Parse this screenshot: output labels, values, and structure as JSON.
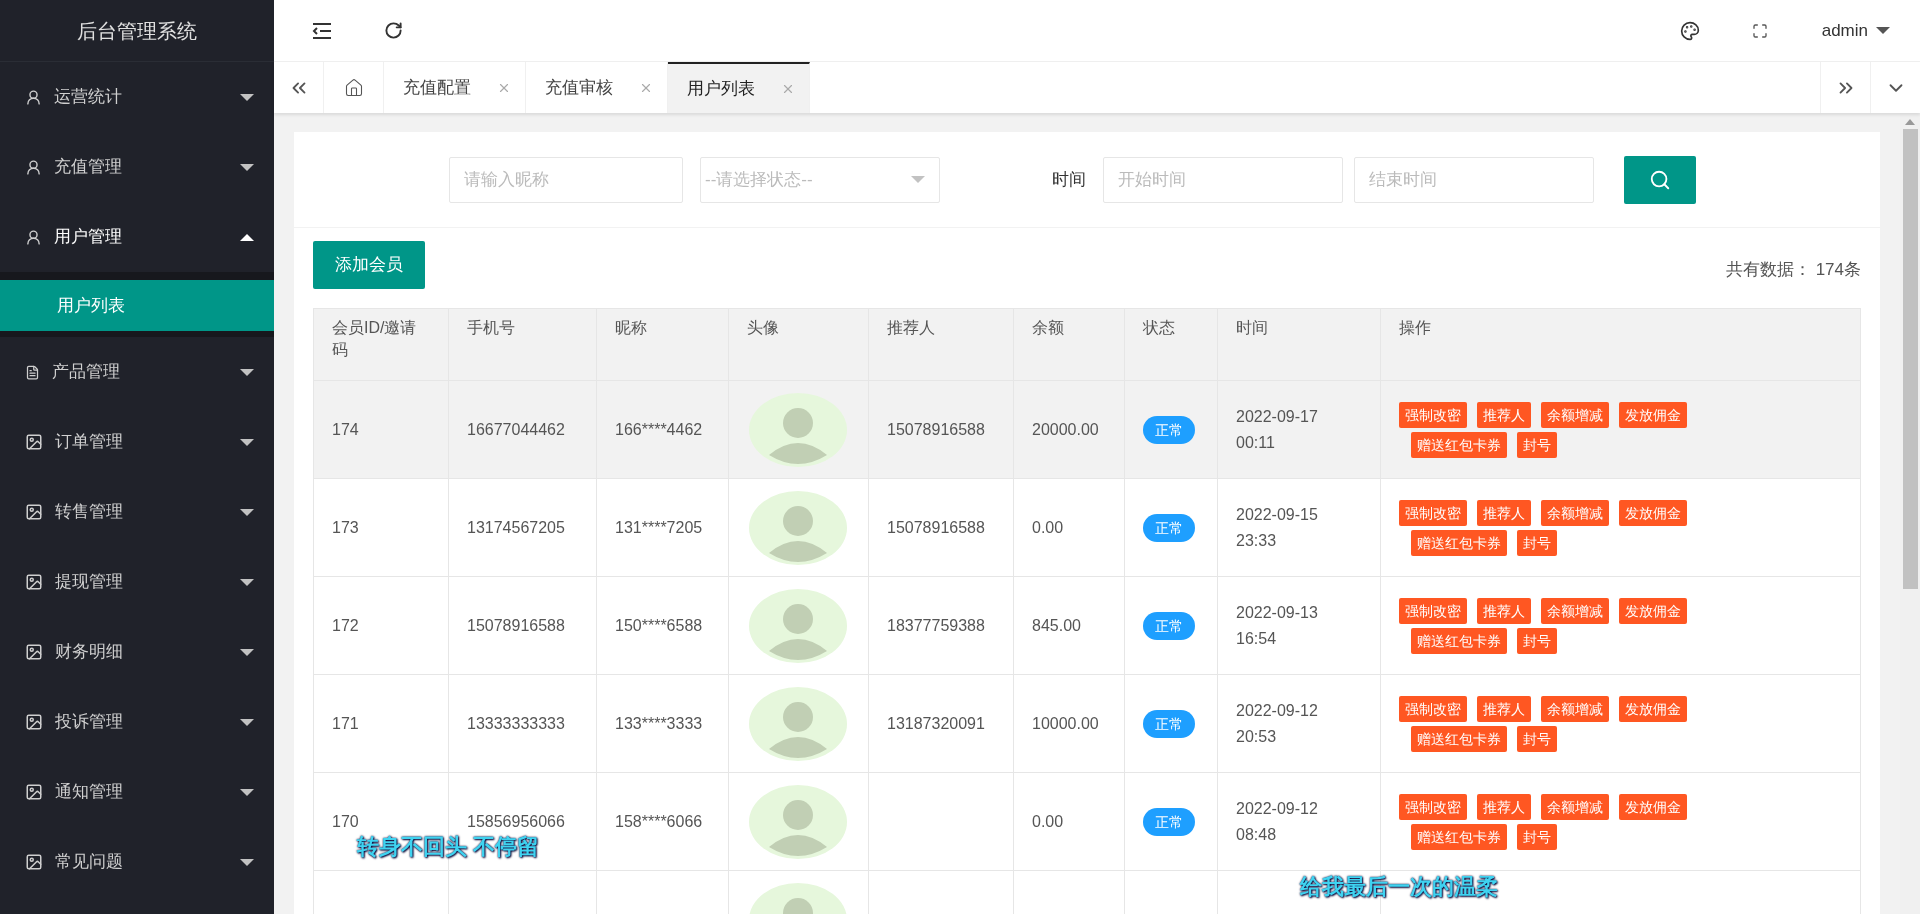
{
  "sidebar": {
    "title": "后台管理系统",
    "items": [
      {
        "label": "运营统计",
        "expanded": false
      },
      {
        "label": "充值管理",
        "expanded": false
      },
      {
        "label": "用户管理",
        "expanded": true,
        "children": [
          {
            "label": "用户列表",
            "selected": true
          }
        ]
      },
      {
        "label": "产品管理",
        "expanded": false
      },
      {
        "label": "订单管理",
        "expanded": false
      },
      {
        "label": "转售管理",
        "expanded": false
      },
      {
        "label": "提现管理",
        "expanded": false
      },
      {
        "label": "财务明细",
        "expanded": false
      },
      {
        "label": "投诉管理",
        "expanded": false
      },
      {
        "label": "通知管理",
        "expanded": false
      },
      {
        "label": "常见问题",
        "expanded": false
      }
    ]
  },
  "topbar": {
    "user": "admin"
  },
  "tabs": [
    {
      "kind": "home",
      "selected": false
    },
    {
      "kind": "page",
      "label": "充值配置",
      "selected": false
    },
    {
      "kind": "page",
      "label": "充值审核",
      "selected": false
    },
    {
      "kind": "page",
      "label": "用户列表",
      "selected": true
    }
  ],
  "filters": {
    "nickname_placeholder": "请输入昵称",
    "status_placeholder": "--请选择状态--",
    "time_label": "时间",
    "start_placeholder": "开始时间",
    "end_placeholder": "结束时间"
  },
  "add_button": "添加会员",
  "total": "共有数据： 174条",
  "table": {
    "columns": [
      "会员ID/邀请码",
      "手机号",
      "昵称",
      "头像",
      "推荐人",
      "余额",
      "状态",
      "时间",
      "操作"
    ],
    "rows": [
      {
        "id": "174",
        "phone": "16677044462",
        "nickname": "166****4462",
        "referrer": "15078916588",
        "balance": "20000.00",
        "status": "正常",
        "time": "2022-09-17 00:11",
        "selected": true,
        "actions": [
          "强制改密",
          "推荐人",
          "余额增减",
          "发放佣金",
          "赠送红包卡券",
          "封号"
        ]
      },
      {
        "id": "173",
        "phone": "13174567205",
        "nickname": "131****7205",
        "referrer": "15078916588",
        "balance": "0.00",
        "status": "正常",
        "time": "2022-09-15 23:33",
        "selected": false,
        "actions": [
          "强制改密",
          "推荐人",
          "余额增减",
          "发放佣金",
          "赠送红包卡券",
          "封号"
        ]
      },
      {
        "id": "172",
        "phone": "15078916588",
        "nickname": "150****6588",
        "referrer": "18377759388",
        "balance": "845.00",
        "status": "正常",
        "time": "2022-09-13 16:54",
        "selected": false,
        "actions": [
          "强制改密",
          "推荐人",
          "余额增减",
          "发放佣金",
          "赠送红包卡券",
          "封号"
        ]
      },
      {
        "id": "171",
        "phone": "13333333333",
        "nickname": "133****3333",
        "referrer": "13187320091",
        "balance": "10000.00",
        "status": "正常",
        "time": "2022-09-12 20:53",
        "selected": false,
        "actions": [
          "强制改密",
          "推荐人",
          "余额增减",
          "发放佣金",
          "赠送红包卡券",
          "封号"
        ]
      },
      {
        "id": "170",
        "phone": "15856956066",
        "nickname": "158****6066",
        "balance": "0.00",
        "status": "正常",
        "time": "2022-09-12 08:48",
        "selected": false,
        "actions": [
          "强制改密",
          "推荐人",
          "余额增减",
          "发放佣金",
          "赠送红包卡券",
          "封号"
        ]
      },
      {
        "selected": false
      }
    ]
  },
  "subtitles": [
    "转身不回头 不停留",
    "给我最后一次的温柔"
  ]
}
